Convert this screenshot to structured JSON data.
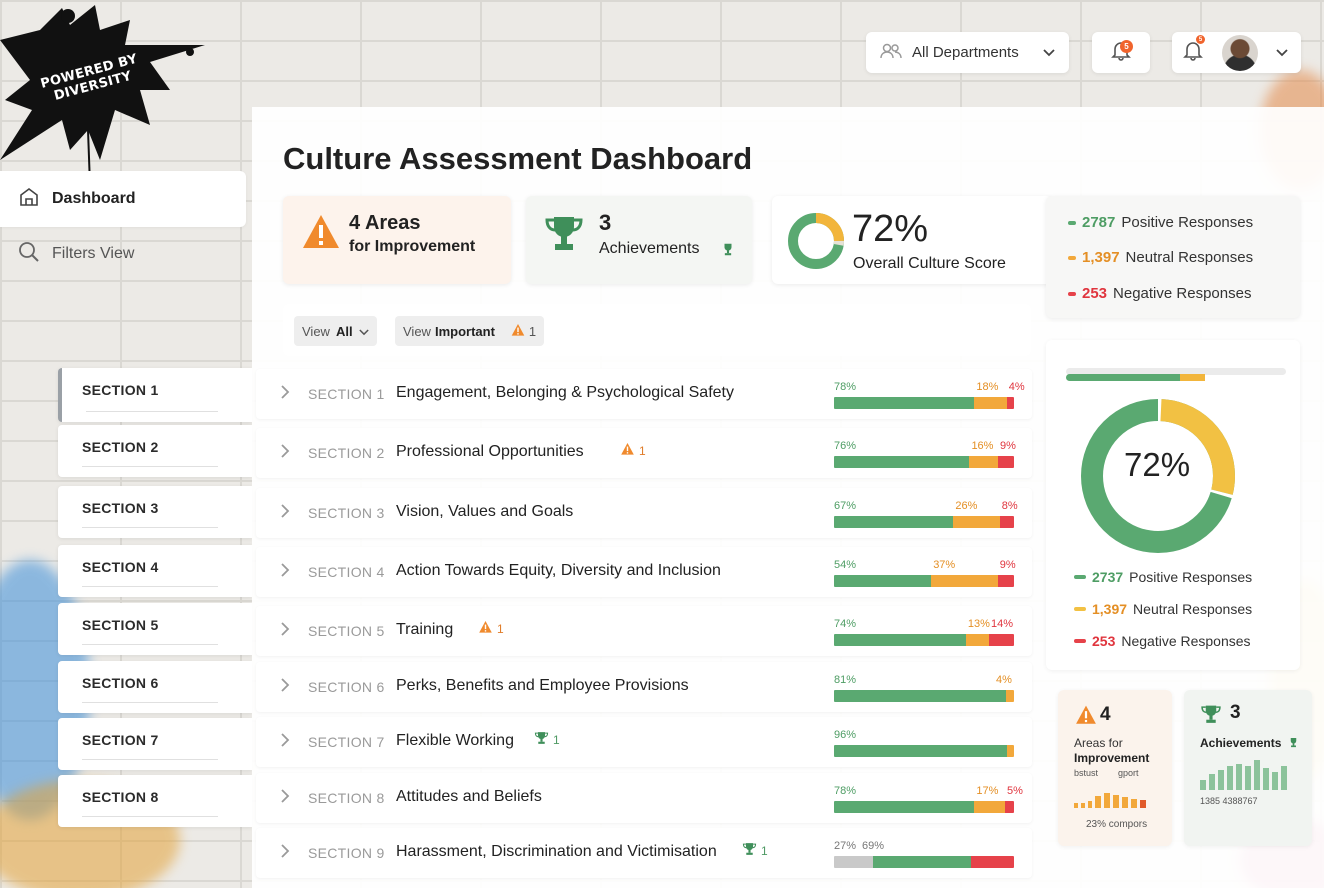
{
  "brand": {
    "logo_text": "POWERED BY DIVERSITY"
  },
  "topbar": {
    "department_label": "All Departments",
    "notif_count_1": "5",
    "notif_count_2": "5"
  },
  "sidebar": {
    "dashboard_label": "Dashboard",
    "filters_label": "Filters View",
    "sections": [
      "SECTION 1",
      "SECTION 2",
      "SECTION 3",
      "SECTION 4",
      "SECTION 5",
      "SECTION 6",
      "SECTION 7",
      "SECTION 8"
    ]
  },
  "page": {
    "title": "Culture Assessment Dashboard"
  },
  "summary": {
    "areas_count": "4 Areas",
    "areas_label": "for Improvement",
    "achievements_count": "3",
    "achievements_label": "Achievements",
    "score_value": "72%",
    "score_label": "Overall Culture Score"
  },
  "responses_top": {
    "positive_value": "2787",
    "positive_label": "Positive Responses",
    "neutral_value": "1,397",
    "neutral_label": "Neutral Responses",
    "negative_value": "253",
    "negative_label": "Negative Responses"
  },
  "view": {
    "all_prefix": "View",
    "all_bold": "All",
    "important_prefix": "View",
    "important_bold": "Important",
    "important_count": "1"
  },
  "rows": [
    {
      "id": "SECTION 1",
      "name": "Engagement, Belonging & Psychological Safety",
      "flag": "",
      "flag_count": "",
      "green": 78,
      "orange": 18,
      "red": 4,
      "g_lbl": "78%",
      "o_lbl": "18%",
      "r_lbl": "4%"
    },
    {
      "id": "SECTION 2",
      "name": "Professional Opportunities",
      "flag": "warning",
      "flag_count": "1",
      "green": 76,
      "orange": 16,
      "red": 9,
      "g_lbl": "76%",
      "o_lbl": "16%",
      "r_lbl": "9%"
    },
    {
      "id": "SECTION 3",
      "name": "Vision, Values and Goals",
      "flag": "",
      "flag_count": "",
      "green": 67,
      "orange": 26,
      "red": 8,
      "g_lbl": "67%",
      "o_lbl": "26%",
      "r_lbl": "8%"
    },
    {
      "id": "SECTION 4",
      "name": "Action Towards Equity, Diversity and Inclusion",
      "flag": "",
      "flag_count": "",
      "green": 54,
      "orange": 37,
      "red": 9,
      "g_lbl": "54%",
      "o_lbl": "37%",
      "r_lbl": "9%"
    },
    {
      "id": "SECTION 5",
      "name": "Training",
      "flag": "warning",
      "flag_count": "1",
      "green": 74,
      "orange": 13,
      "red": 14,
      "g_lbl": "74%",
      "o_lbl": "13%",
      "r_lbl": "14%"
    },
    {
      "id": "SECTION 6",
      "name": "Perks, Benefits and Employee Provisions",
      "flag": "",
      "flag_count": "",
      "green": 81,
      "orange": 4,
      "red": 0,
      "g_lbl": "81%",
      "o_lbl": "4%",
      "r_lbl": ""
    },
    {
      "id": "SECTION 7",
      "name": "Flexible Working",
      "flag": "trophy",
      "flag_count": "1",
      "green": 96,
      "orange": 4,
      "red": 0,
      "g_lbl": "96%",
      "o_lbl": "",
      "r_lbl": ""
    },
    {
      "id": "SECTION 8",
      "name": "Attitudes and Beliefs",
      "flag": "",
      "flag_count": "",
      "green": 78,
      "orange": 17,
      "red": 5,
      "g_lbl": "78%",
      "o_lbl": "17%",
      "r_lbl": "5%"
    },
    {
      "id": "SECTION 9",
      "name": "Harassment, Discrimination and Victimisation",
      "flag": "trophy",
      "flag_count": "1",
      "grey": 27,
      "green": 69,
      "red": 30,
      "gy_lbl": "27%",
      "g_lbl": "69%"
    }
  ],
  "right_panel": {
    "donut_value": "72%",
    "positive_value": "2737",
    "positive_label": "Positive Responses",
    "neutral_value": "1,397",
    "neutral_label": "Neutral Responses",
    "negative_value": "253",
    "negative_label": "Negative Responses"
  },
  "mini_cards": {
    "areas_count": "4",
    "areas_label": "Areas for",
    "areas_label_bold": "Improvement",
    "areas_sub": "bstust",
    "areas_sub2": "gport",
    "areas_foot": "23% compors",
    "ach_count": "3",
    "ach_label": "Achievements",
    "ach_foot": "1385 4388767"
  },
  "colors": {
    "green": "#5aa971",
    "orange": "#f2a83b",
    "red": "#e6424a",
    "accent": "#f0642d"
  }
}
